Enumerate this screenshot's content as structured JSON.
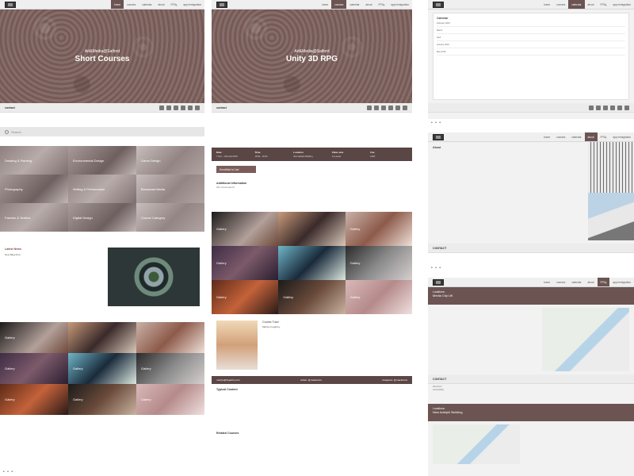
{
  "nav": {
    "home": "home",
    "courses": "courses",
    "calendar": "calendar",
    "about": "about",
    "ffsq": "FFSq",
    "app": "app immigration"
  },
  "page1": {
    "hero_sup": "Art&Media@Salford",
    "hero_title": "Short Courses",
    "contact_label": "contact",
    "search_placeholder": "Search",
    "categories": [
      "Drawing & Painting",
      "Environmental Design",
      "Game Design",
      "Photography",
      "Writing & Performance",
      "Broadcast Media",
      "Fashion & Textiles",
      "Digital Design",
      "Course Category"
    ],
    "news_heading": "Latest News",
    "news_sub": "New Blog Post",
    "gallery_label": "Gallery"
  },
  "page2": {
    "hero_sup": "Art&Media@Salford",
    "hero_title": "Unity 3D RPG",
    "contact_label": "contact",
    "info": {
      "headers": [
        "Date",
        "Time",
        "Location",
        "Class size",
        "Fee"
      ],
      "values": [
        "7 Feb – 14th April 2015",
        "18:00 – 20:00",
        "New Adelphi Building",
        "12 people",
        "£180"
      ]
    },
    "enrol_label": "Enrol/Add to Cart",
    "additional_heading": "Additional Information",
    "who_label": "Who should attend?",
    "tutor_heading": "Course Tutor",
    "tutor_name": "Marilyn Fogarthy",
    "footer": {
      "email": "marilyn@fogarthy.com",
      "twitter": "twitter: @maefuturis",
      "instagram": "instagram: @maefuturis"
    },
    "topics_heading": "Typical Content",
    "related_heading": "Related Courses",
    "gallery_label": "Gallery"
  },
  "page3": {
    "heading": "Calendar",
    "rows": [
      "February 2015",
      "March",
      "April",
      "January 2016",
      "May 2016"
    ]
  },
  "page4": {
    "heading": "About",
    "contact_label": "CONTACT"
  },
  "page5": {
    "loc1_a": "Locations:",
    "loc1_b": "Media City UK",
    "loc2_a": "Locations:",
    "loc2_b": "New Adelphi Building",
    "contact_label": "CONTACT",
    "directions": "Directions",
    "accessibility": "Accessibility"
  },
  "pages_dots": "• • •"
}
